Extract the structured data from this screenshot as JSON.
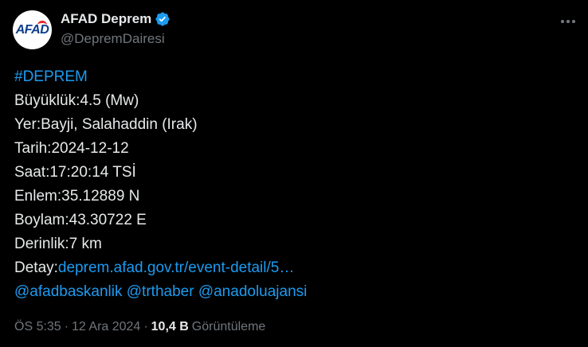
{
  "author": {
    "avatar_text": "AFAD",
    "display_name": "AFAD Deprem",
    "handle": "@DepremDairesi"
  },
  "tweet": {
    "hashtag": "#DEPREM",
    "lines": [
      "Büyüklük:4.5 (Mw)",
      "Yer:Bayji, Salahaddin (Irak)",
      "Tarih:2024-12-12",
      "Saat:17:20:14 TSİ",
      "Enlem:35.12889 N",
      "Boylam:43.30722 E",
      "Derinlik:7 km"
    ],
    "detail_label": "Detay:",
    "detail_link": "deprem.afad.gov.tr/event-detail/5…",
    "mentions": [
      "@afadbaskanlik",
      "@trthaber",
      "@anadoluajansi"
    ]
  },
  "meta": {
    "time": "ÖS 5:35",
    "separator": "·",
    "date": "12 Ara 2024",
    "views_count": "10,4 B",
    "views_label": "Görüntüleme"
  },
  "colors": {
    "background": "#000000",
    "text": "#e7e9ea",
    "secondary": "#71767b",
    "link": "#1d9bf0",
    "verified": "#1d9bf0"
  },
  "icons": {
    "verified": "verified-badge-icon",
    "more": "more-options-icon"
  }
}
